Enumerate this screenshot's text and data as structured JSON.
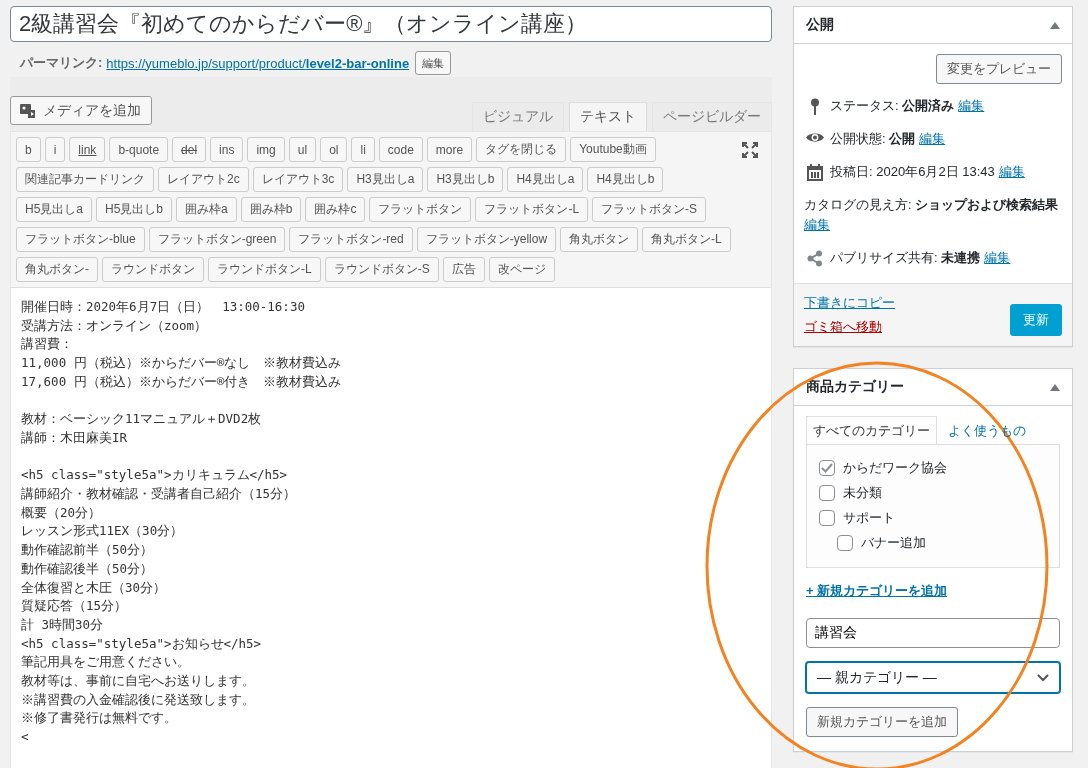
{
  "title": {
    "value": "2級講習会『初めてのからだバー®』（オンライン講座）"
  },
  "permalink": {
    "label": "パーマリンク:",
    "url_base": "https://yumeblo.jp/support/product/",
    "slug": "level2-bar-online",
    "edit_button": "編集"
  },
  "media_button": "メディアを追加",
  "editor_tabs": [
    {
      "label": "ビジュアル",
      "selected": false
    },
    {
      "label": "テキスト",
      "selected": true
    },
    {
      "label": "ページビルダー",
      "selected": false
    }
  ],
  "quicktag_rows": [
    [
      {
        "label": "b",
        "kind": "plain"
      },
      {
        "label": "i",
        "kind": "plain"
      },
      {
        "label": "link",
        "kind": "link"
      },
      {
        "label": "b-quote",
        "kind": "plain"
      },
      {
        "label": "del",
        "kind": "del"
      },
      {
        "label": "ins",
        "kind": "plain"
      },
      {
        "label": "img",
        "kind": "plain"
      },
      {
        "label": "ul",
        "kind": "plain"
      },
      {
        "label": "ol",
        "kind": "plain"
      },
      {
        "label": "li",
        "kind": "plain"
      },
      {
        "label": "code",
        "kind": "plain"
      },
      {
        "label": "more",
        "kind": "plain"
      },
      {
        "label": "タグを閉じる",
        "kind": "plain"
      },
      {
        "label": "Youtube動画",
        "kind": "plain"
      }
    ],
    [
      {
        "label": "関連記事カードリンク",
        "kind": "plain"
      },
      {
        "label": "レイアウト2c",
        "kind": "plain"
      },
      {
        "label": "レイアウト3c",
        "kind": "plain"
      },
      {
        "label": "H3見出しa",
        "kind": "plain"
      },
      {
        "label": "H3見出しb",
        "kind": "plain"
      },
      {
        "label": "H4見出しa",
        "kind": "plain"
      },
      {
        "label": "H4見出しb",
        "kind": "plain"
      }
    ],
    [
      {
        "label": "H5見出しa",
        "kind": "plain"
      },
      {
        "label": "H5見出しb",
        "kind": "plain"
      },
      {
        "label": "囲み枠a",
        "kind": "plain"
      },
      {
        "label": "囲み枠b",
        "kind": "plain"
      },
      {
        "label": "囲み枠c",
        "kind": "plain"
      },
      {
        "label": "フラットボタン",
        "kind": "plain"
      },
      {
        "label": "フラットボタン-L",
        "kind": "plain"
      },
      {
        "label": "フラットボタン-S",
        "kind": "plain"
      }
    ],
    [
      {
        "label": "フラットボタン-blue",
        "kind": "plain"
      },
      {
        "label": "フラットボタン-green",
        "kind": "plain"
      },
      {
        "label": "フラットボタン-red",
        "kind": "plain"
      },
      {
        "label": "フラットボタン-yellow",
        "kind": "plain"
      },
      {
        "label": "角丸ボタン",
        "kind": "plain"
      },
      {
        "label": "角丸ボタン-L",
        "kind": "plain"
      }
    ],
    [
      {
        "label": "角丸ボタン-",
        "kind": "plain"
      },
      {
        "label": "ラウンドボタン",
        "kind": "plain"
      },
      {
        "label": "ラウンドボタン-L",
        "kind": "plain"
      },
      {
        "label": "ラウンドボタン-S",
        "kind": "plain"
      },
      {
        "label": "広告",
        "kind": "plain"
      },
      {
        "label": "改ページ",
        "kind": "plain"
      }
    ]
  ],
  "content_blocks": [
    [
      "開催日時：2020年6月7日（日）　13:00-16:30",
      "受講方法：オンライン（zoom）",
      "講習費：",
      "11,000 円（税込）※からだバー®なし　※教材費込み",
      "17,600 円（税込）※からだバー®付き　※教材費込み"
    ],
    [
      "教材：ベーシック11マニュアル＋DVD2枚",
      "講師：木田麻美IR"
    ],
    [
      "<h5 class=\"style5a\">カリキュラム</h5>",
      "講師紹介・教材確認・受講者自己紹介（15分）",
      "概要（20分）",
      "レッスン形式11EX（30分）",
      "動作確認前半（50分）",
      "動作確認後半（50分）",
      "全体復習と木圧（30分）",
      "質疑応答（15分）",
      "計 3時間30分",
      "<h5 class=\"style5a\">お知らせ</h5>",
      "筆記用具をご用意ください。",
      "教材等は、事前に自宅へお送りします。",
      "※講習費の入金確認後に発送致します。",
      "※修了書発行は無料です。",
      "<"
    ]
  ],
  "publish": {
    "title": "公開",
    "preview_button": "変更をプレビュー",
    "rows": [
      {
        "kind": "status",
        "label": "ステータス:",
        "value": "公開済み",
        "link": "編集"
      },
      {
        "kind": "visibility",
        "label": "公開状態:",
        "value": "公開",
        "link": "編集"
      },
      {
        "kind": "date",
        "label": "投稿日:",
        "value": "2020年6月2日 13:43",
        "link": "編集"
      },
      {
        "kind": "catalog",
        "label": "カタログの見え方:",
        "value": "ショップおよび検索結果",
        "link": "編集"
      },
      {
        "kind": "share",
        "label": "パブリサイズ共有:",
        "value": "未連携",
        "link": "編集"
      }
    ],
    "copy_link": "下書きにコピー",
    "trash_link": "ゴミ箱へ移動",
    "update_button": "更新"
  },
  "categories": {
    "title": "商品カテゴリー",
    "tabs": [
      {
        "label": "すべてのカテゴリー",
        "selected": true
      },
      {
        "label": "よく使うもの",
        "selected": false
      }
    ],
    "items": [
      {
        "label": "からだワーク協会",
        "checked": true
      },
      {
        "label": "未分類",
        "checked": false
      },
      {
        "label": "サポート",
        "checked": false,
        "children": [
          {
            "label": "バナー追加",
            "checked": false
          }
        ]
      }
    ],
    "add_link": "+ 新規カテゴリーを追加",
    "new_name": "講習会",
    "parent_select": "— 親カテゴリー —",
    "add_button": "新規カテゴリーを追加"
  }
}
